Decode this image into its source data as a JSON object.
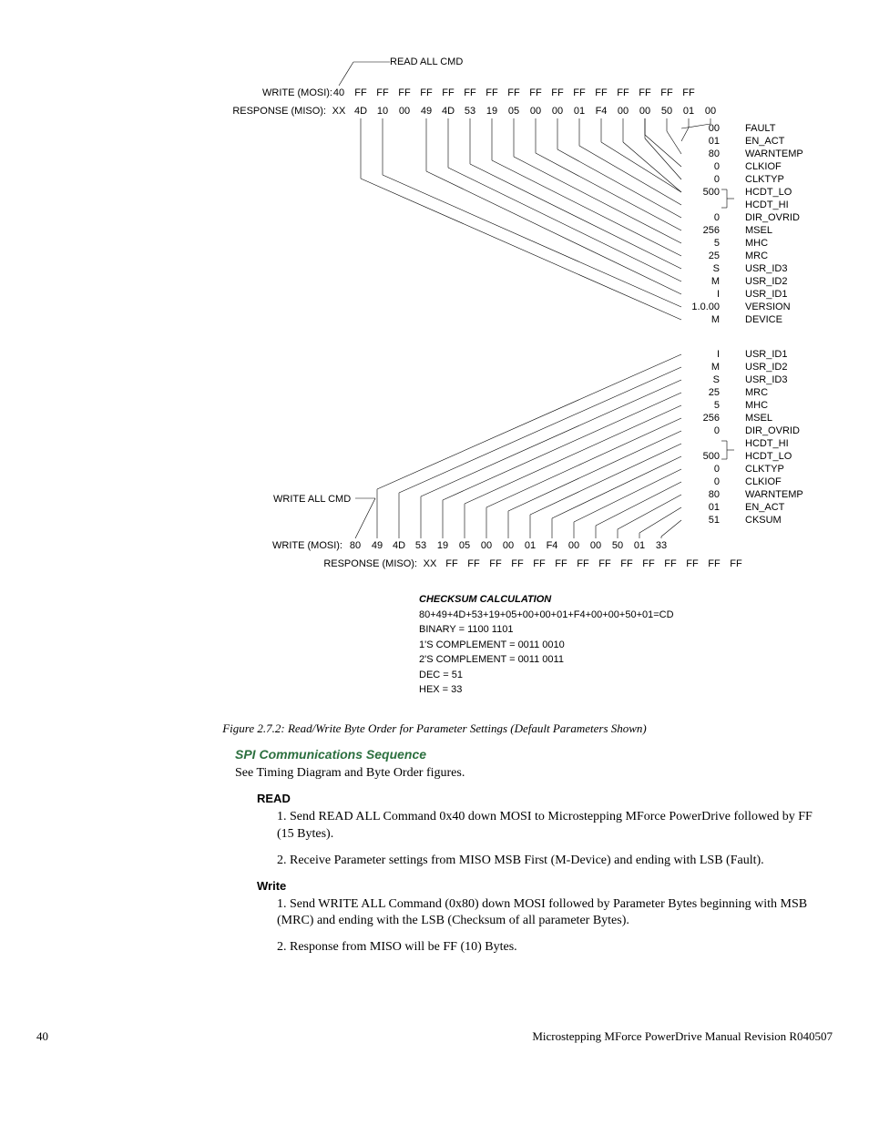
{
  "diagram_top": {
    "read_all_cmd": "READ ALL CMD",
    "write_label": "WRITE (MOSI):",
    "response_label": "RESPONSE (MISO):",
    "write_bytes": [
      "40",
      "FF",
      "FF",
      "FF",
      "FF",
      "FF",
      "FF",
      "FF",
      "FF",
      "FF",
      "FF",
      "FF",
      "FF",
      "FF",
      "FF",
      "FF",
      "FF"
    ],
    "response_bytes": [
      "XX",
      "4D",
      "10",
      "00",
      "49",
      "4D",
      "53",
      "19",
      "05",
      "00",
      "00",
      "01",
      "F4",
      "00",
      "00",
      "50",
      "01",
      "00"
    ],
    "fanout": [
      {
        "value": "00",
        "name": "FAULT"
      },
      {
        "value": "01",
        "name": "EN_ACT"
      },
      {
        "value": "80",
        "name": "WARNTEMP"
      },
      {
        "value": "0",
        "name": "CLKIOF"
      },
      {
        "value": "0",
        "name": "CLKTYP"
      },
      {
        "value": "500",
        "name": "HCDT_LO"
      },
      {
        "value": "",
        "name": "HCDT_HI"
      },
      {
        "value": "0",
        "name": "DIR_OVRID"
      },
      {
        "value": "256",
        "name": "MSEL"
      },
      {
        "value": "5",
        "name": "MHC"
      },
      {
        "value": "25",
        "name": "MRC"
      },
      {
        "value": "S",
        "name": "USR_ID3"
      },
      {
        "value": "M",
        "name": "USR_ID2"
      },
      {
        "value": "I",
        "name": "USR_ID1"
      },
      {
        "value": "1.0.00",
        "name": "VERSION"
      },
      {
        "value": "M",
        "name": "DEVICE"
      }
    ]
  },
  "diagram_bottom": {
    "write_all_cmd": "WRITE ALL CMD",
    "write_label": "WRITE (MOSI):",
    "response_label": "RESPONSE (MISO):",
    "write_bytes": [
      "80",
      "49",
      "4D",
      "53",
      "19",
      "05",
      "00",
      "00",
      "01",
      "F4",
      "00",
      "00",
      "50",
      "01",
      "33"
    ],
    "response_bytes": [
      "XX",
      "FF",
      "FF",
      "FF",
      "FF",
      "FF",
      "FF",
      "FF",
      "FF",
      "FF",
      "FF",
      "FF",
      "FF",
      "FF",
      "FF"
    ],
    "fanout": [
      {
        "value": "I",
        "name": "USR_ID1"
      },
      {
        "value": "M",
        "name": "USR_ID2"
      },
      {
        "value": "S",
        "name": "USR_ID3"
      },
      {
        "value": "25",
        "name": "MRC"
      },
      {
        "value": "5",
        "name": "MHC"
      },
      {
        "value": "256",
        "name": "MSEL"
      },
      {
        "value": "0",
        "name": "DIR_OVRID"
      },
      {
        "value": "",
        "name": "HCDT_HI"
      },
      {
        "value": "500",
        "name": "HCDT_LO"
      },
      {
        "value": "0",
        "name": "CLKTYP"
      },
      {
        "value": "0",
        "name": "CLKIOF"
      },
      {
        "value": "80",
        "name": "WARNTEMP"
      },
      {
        "value": "01",
        "name": "EN_ACT"
      },
      {
        "value": "51",
        "name": "CKSUM"
      }
    ]
  },
  "checksum": {
    "title": "CHECKSUM CALCULATION",
    "sum": "80+49+4D+53+19+05+00+00+01+F4+00+00+50+01=CD",
    "binary": "BINARY = 1100 1101",
    "ones": "1'S COMPLEMENT = 0011 0010",
    "twos": "2'S COMPLEMENT = 0011 0011",
    "dec": "DEC = 51",
    "hex": "HEX = 33"
  },
  "caption": "Figure 2.7.2: Read/Write Byte Order for Parameter Settings (Default Parameters Shown)",
  "section": {
    "title": "SPI Communications Sequence",
    "intro": "See Timing Diagram and Byte Order figures.",
    "read": {
      "head": "READ",
      "step1": "1. Send READ ALL Command 0x40 down MOSI to Microstepping MForce PowerDrive followed by FF (15 Bytes).",
      "step2": "2. Receive Parameter settings from MISO MSB First (M-Device) and ending with LSB (Fault)."
    },
    "write": {
      "head": "Write",
      "step1": "1. Send WRITE ALL Command (0x80) down MOSI followed by Parameter Bytes beginning with MSB (MRC) and ending with the LSB (Checksum of all parameter Bytes).",
      "step2": "2. Response from MISO will be FF (10) Bytes."
    }
  },
  "footer": {
    "page": "40",
    "manual": "Microstepping MForce PowerDrive Manual Revision R040507"
  }
}
